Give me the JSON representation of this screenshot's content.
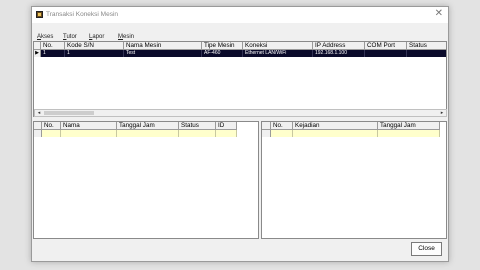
{
  "window": {
    "title": "Transaksi Koneksi Mesin",
    "close_glyph": "✕"
  },
  "menu": [
    {
      "label": "Akses",
      "accel": "A",
      "rest": "kses"
    },
    {
      "label": "Tutor",
      "accel": "T",
      "rest": "utor"
    },
    {
      "label": "Lapor",
      "accel": "L",
      "rest": "apor"
    },
    {
      "label": "Mesin",
      "accel": "M",
      "rest": "esin"
    }
  ],
  "machines_grid": {
    "columns": [
      "No.",
      "Kode S/N",
      "Nama Mesin",
      "Tipe Mesin",
      "Koneksi",
      "IP Address",
      "COM Port",
      "Status"
    ],
    "rows": [
      {
        "indicator": "▶",
        "no": "1",
        "kode": "1",
        "nama": "Test",
        "tipe": "AF-460",
        "koneksi": "Ethernet LAN/WiFi",
        "ip": "192.168.1.100",
        "com": "",
        "status": ""
      }
    ]
  },
  "scroll": {
    "left_arrow": "◂",
    "right_arrow": "▸"
  },
  "users_grid": {
    "columns": [
      "No.",
      "Nama",
      "Tanggal Jam",
      "Status",
      "ID"
    ]
  },
  "events_grid": {
    "columns": [
      "No.",
      "Kejadian",
      "Tanggal Jam"
    ]
  },
  "close_button": {
    "label": "Close"
  }
}
